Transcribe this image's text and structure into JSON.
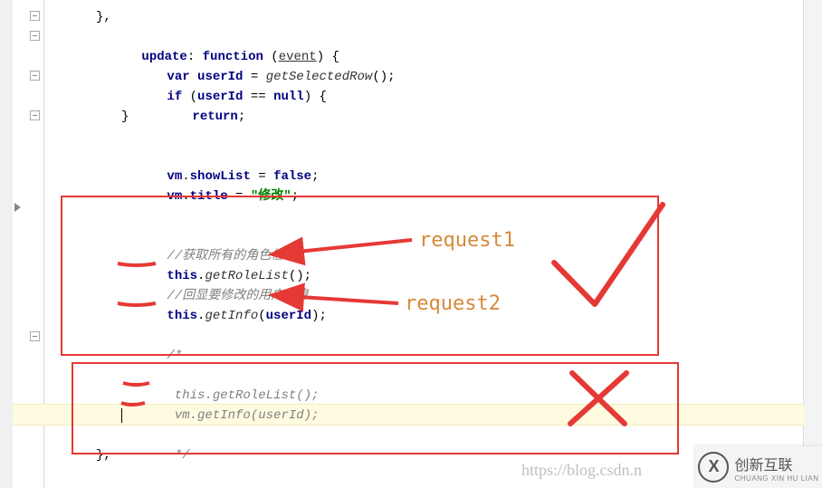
{
  "lines": {
    "l0": "},",
    "l1_name": "update",
    "l1_kw": "function",
    "l1_param": "event",
    "l2_var": "var",
    "l2_name": "userId",
    "l2_call": "getSelectedRow",
    "l3_if": "if",
    "l3_cond_name": "userId",
    "l3_null": "null",
    "l4_return": "return",
    "l5": "}",
    "l7_obj": "vm",
    "l7_prop": "showList",
    "l7_val": "false",
    "l8_obj": "vm",
    "l8_prop": "title",
    "l8_str": "\"修改\"",
    "l10_comment": "//获取所有的角色信息",
    "l11_this": "this",
    "l11_call": "getRoleList",
    "l12_comment": "//回显要修改的用户信息",
    "l13_this": "this",
    "l13_call": "getInfo",
    "l13_arg": "userId",
    "l15": "/*",
    "l16": " this.getRoleList();",
    "l17": " vm.getInfo(userId);",
    "l19": " */",
    "l20": "},"
  },
  "annotations": {
    "req1": "request1",
    "req2": "request2"
  },
  "watermark": {
    "url": "https://blog.csdn.n",
    "logo_text": "创新互联",
    "logo_sub": "CHUANG XIN HU LIAN"
  }
}
